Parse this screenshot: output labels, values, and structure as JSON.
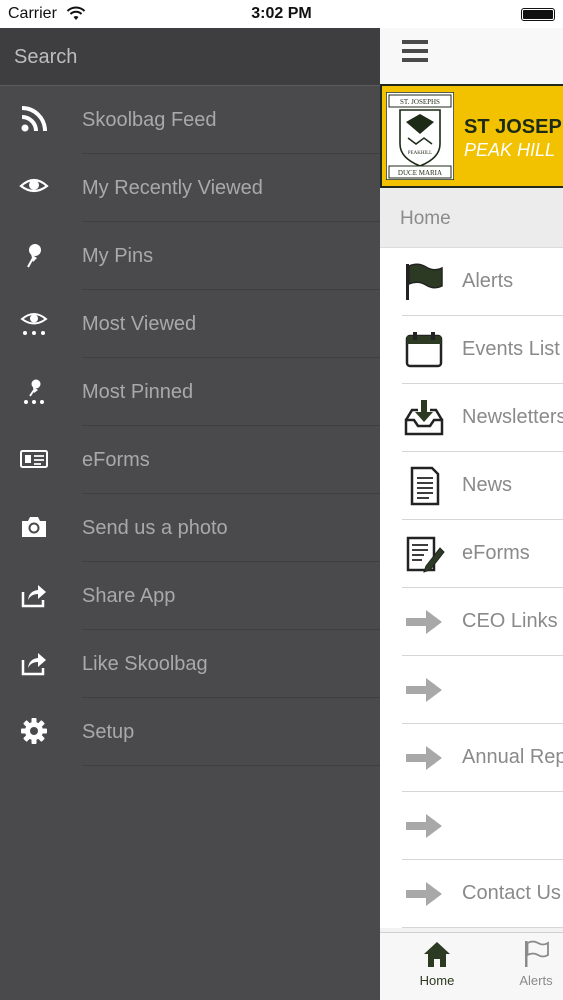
{
  "status_bar": {
    "carrier": "Carrier",
    "time": "3:02 PM"
  },
  "drawer": {
    "search_placeholder": "Search",
    "items": [
      {
        "label": "Skoolbag Feed",
        "icon": "rss-icon"
      },
      {
        "label": "My Recently Viewed",
        "icon": "eye-icon"
      },
      {
        "label": "My Pins",
        "icon": "pin-icon"
      },
      {
        "label": "Most Viewed",
        "icon": "most-viewed-icon"
      },
      {
        "label": "Most Pinned",
        "icon": "most-pinned-icon"
      },
      {
        "label": "eForms",
        "icon": "id-card-icon"
      },
      {
        "label": "Send us a photo",
        "icon": "camera-icon"
      },
      {
        "label": "Share App",
        "icon": "share-icon"
      },
      {
        "label": "Like Skoolbag",
        "icon": "share-icon"
      },
      {
        "label": "Setup",
        "icon": "gear-icon"
      }
    ]
  },
  "main": {
    "banner": {
      "crest_top": "ST. JOSEPHS",
      "crest_bottom": "DUCE MARIA",
      "crest_side": "PEAKHILL",
      "title": "ST JOSEPH",
      "subtitle": "PEAK HILL"
    },
    "breadcrumb": "Home",
    "items": [
      {
        "label": "Alerts",
        "icon": "flag-icon"
      },
      {
        "label": "Events List",
        "icon": "calendar-icon"
      },
      {
        "label": "Newsletters",
        "icon": "download-tray-icon"
      },
      {
        "label": "News",
        "icon": "document-icon"
      },
      {
        "label": "eForms",
        "icon": "form-pen-icon"
      },
      {
        "label": "CEO Links",
        "icon": "arrow-right-icon"
      },
      {
        "label": "",
        "icon": "arrow-right-icon"
      },
      {
        "label": "Annual Rep",
        "icon": "arrow-right-icon"
      },
      {
        "label": "",
        "icon": "arrow-right-icon"
      },
      {
        "label": "Contact Us",
        "icon": "arrow-right-icon"
      }
    ],
    "tabs": [
      {
        "label": "Home",
        "icon": "home-icon",
        "active": true
      },
      {
        "label": "Alerts",
        "icon": "flag-icon",
        "active": false
      }
    ]
  },
  "colors": {
    "drawer_bg": "#4a4a4c",
    "banner_yellow": "#f2c200",
    "banner_dark": "#1f2a1b",
    "active_tab": "#2b3a20"
  }
}
